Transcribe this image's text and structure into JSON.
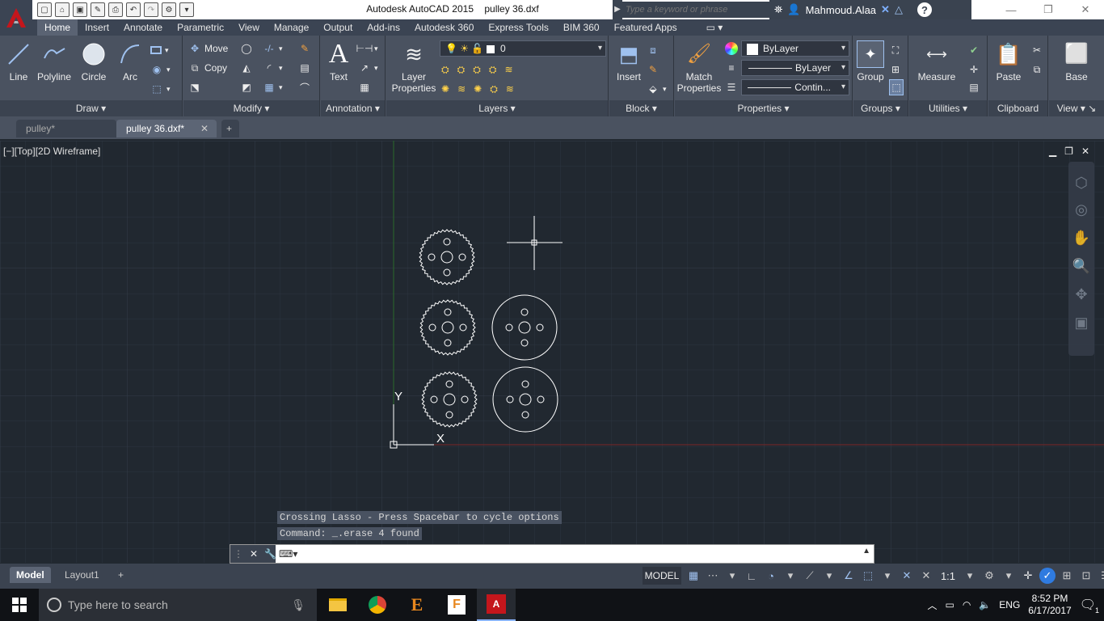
{
  "app": {
    "title": "Autodesk AutoCAD 2015",
    "file": "pulley 36.dxf",
    "search_placeholder": "Type a keyword or phrase",
    "user": "Mahmoud.Alaa"
  },
  "ribbon_tabs": [
    "Home",
    "Insert",
    "Annotate",
    "Parametric",
    "View",
    "Manage",
    "Output",
    "Add-ins",
    "Autodesk 360",
    "Express Tools",
    "BIM 360",
    "Featured Apps"
  ],
  "active_tab": "Home",
  "ribbon": {
    "draw": {
      "title": "Draw",
      "line": "Line",
      "polyline": "Polyline",
      "circle": "Circle",
      "arc": "Arc"
    },
    "modify": {
      "title": "Modify",
      "move": "Move",
      "copy": "Copy"
    },
    "annotation": {
      "title": "Annotation",
      "text": "Text"
    },
    "layers": {
      "title": "Layers",
      "layer_properties_1": "Layer",
      "layer_properties_2": "Properties",
      "current_layer": "0"
    },
    "block": {
      "title": "Block",
      "insert": "Insert"
    },
    "properties": {
      "title": "Properties",
      "match_1": "Match",
      "match_2": "Properties",
      "color": "ByLayer",
      "lineweight": "ByLayer",
      "linetype": "Contin..."
    },
    "groups": {
      "title": "Groups",
      "group": "Group"
    },
    "utilities": {
      "title": "Utilities",
      "measure": "Measure"
    },
    "clipboard": {
      "title": "Clipboard",
      "paste": "Paste"
    },
    "view": {
      "title": "View",
      "base": "Base"
    }
  },
  "doc_tabs": [
    {
      "label": "pulley*",
      "active": false
    },
    {
      "label": "pulley 36.dxf*",
      "active": true
    }
  ],
  "viewport": {
    "label": "[−][Top][2D Wireframe]",
    "ucs_y": "Y",
    "ucs_x": "X"
  },
  "command": {
    "history": [
      "Crossing Lasso - Press Spacebar to cycle options",
      "Command: _.erase 4 found"
    ],
    "input": ""
  },
  "status": {
    "layout_tabs": [
      "Model",
      "Layout1"
    ],
    "active_layout": "Model",
    "model_label": "MODEL",
    "scale": "1:1"
  },
  "taskbar": {
    "search_placeholder": "Type here to search",
    "language": "ENG",
    "time": "8:52 PM",
    "date": "6/17/2017",
    "notifications": "1"
  },
  "colors": {
    "canvas": "#212830",
    "ribbon": "#4a5260",
    "geometry": "#ffffff",
    "x_axis": "#8a2a2a",
    "y_axis": "#2a7a2a",
    "autocad_red": "#c4161c"
  }
}
